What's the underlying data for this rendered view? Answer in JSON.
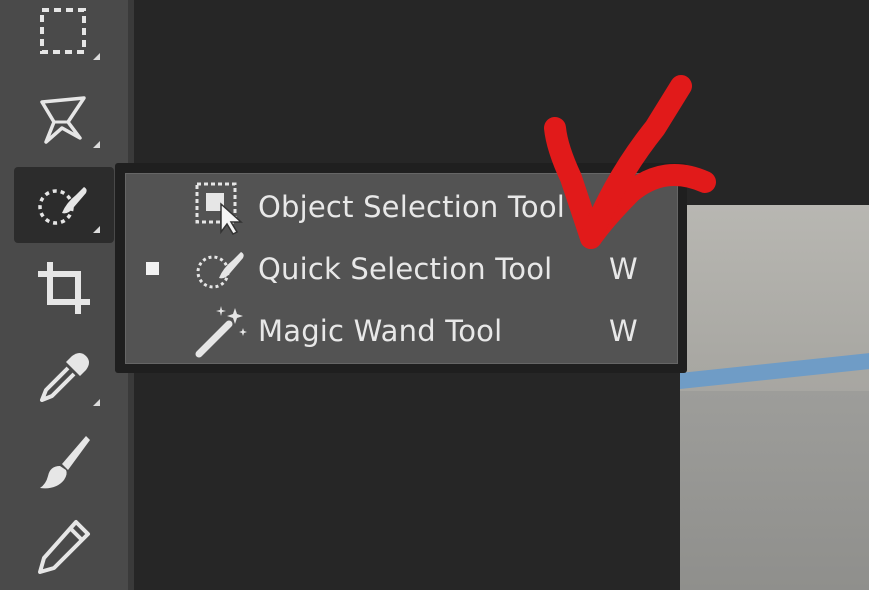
{
  "colors": {
    "toolbar_bg": "#4a4a4a",
    "workspace_bg": "#262626",
    "flyout_bg": "#535353",
    "annotation_red": "#e11a1a"
  },
  "toolbar": {
    "tools": [
      {
        "name": "rectangular-marquee-tool",
        "icon": "dashed-rect-icon"
      },
      {
        "name": "lasso-tool",
        "icon": "lasso-icon"
      },
      {
        "name": "quick-selection-tool",
        "icon": "quick-selection-icon",
        "active": true
      },
      {
        "name": "crop-tool",
        "icon": "crop-icon"
      },
      {
        "name": "eyedropper-tool",
        "icon": "eyedropper-icon"
      },
      {
        "name": "brush-tool",
        "icon": "brush-icon"
      },
      {
        "name": "pencil-tool",
        "icon": "pencil-icon"
      }
    ]
  },
  "flyout": {
    "items": [
      {
        "label": "Object Selection Tool",
        "shortcut": "",
        "icon": "object-selection-icon",
        "selected": false
      },
      {
        "label": "Quick Selection Tool",
        "shortcut": "W",
        "icon": "quick-selection-icon",
        "selected": true
      },
      {
        "label": "Magic Wand Tool",
        "shortcut": "W",
        "icon": "magic-wand-icon",
        "selected": false
      }
    ]
  },
  "annotation": {
    "icon": "red-checkmark-icon"
  }
}
